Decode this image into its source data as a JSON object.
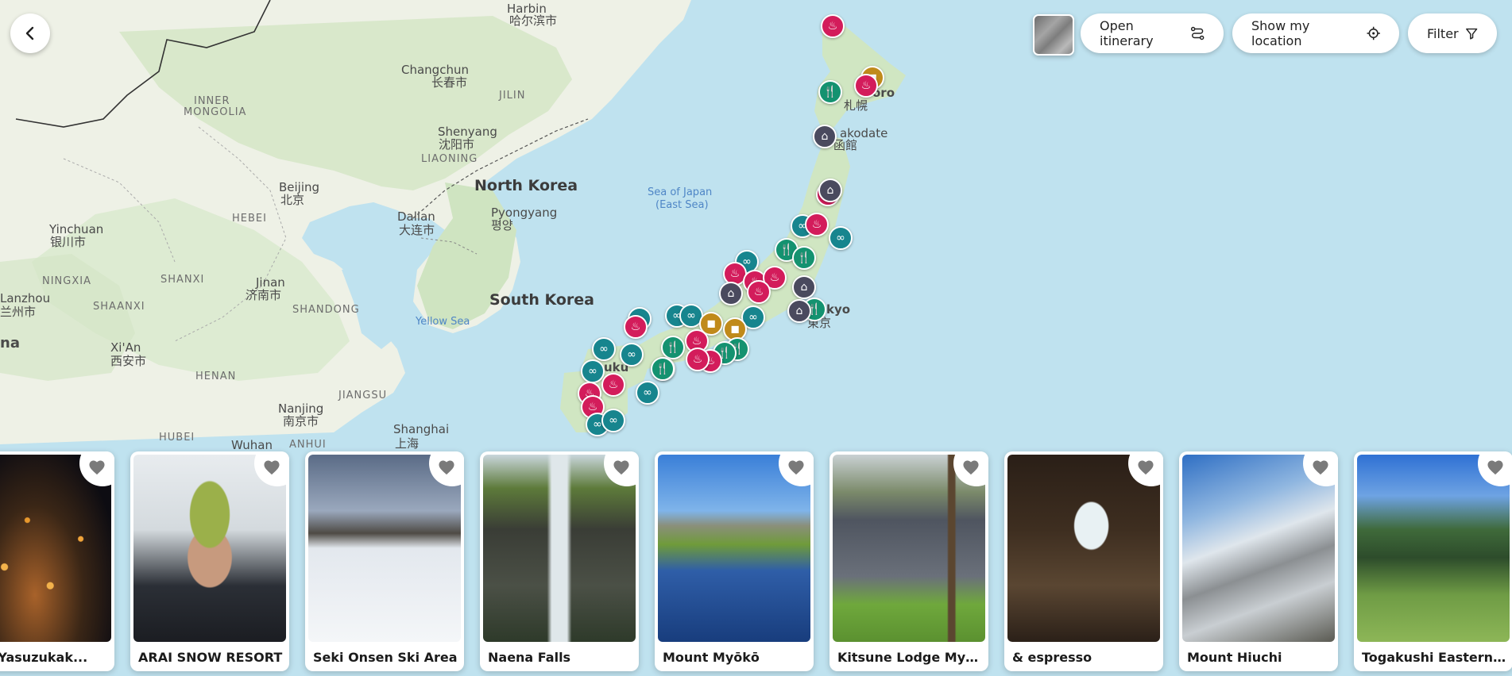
{
  "toolbar": {
    "open_itinerary_label": "Open itinerary",
    "show_location_label": "Show my location",
    "filter_label": "Filter"
  },
  "colors": {
    "food_pin": "#149270",
    "sight_pin": "#17858e",
    "onsen_pin": "#d31c5b",
    "hotel_pin": "#4a4a5e",
    "shop_pin": "#c08a1a",
    "water": "#bfe2ef",
    "land": "#eef1e6"
  },
  "map": {
    "countries": {
      "north_korea": "North Korea",
      "north_korea_local": "Pyongyang",
      "south_korea": "South Korea",
      "inner_mongolia_1": "INNER",
      "inner_mongolia_2": "MONGOLIA"
    },
    "cities": {
      "harbin": "Harbin",
      "harbin_local": "哈尔滨市",
      "changchun": "Changchun",
      "changchun_local": "长春市",
      "shenyang": "Shenyang",
      "shenyang_local": "沈阳市",
      "beijing": "Beijing",
      "beijing_local": "北京",
      "dalian": "Dalian",
      "dalian_local": "大连市",
      "pyongyang_local": "평양",
      "yinchuan": "Yinchuan",
      "yinchuan_local": "银川市",
      "lanzhou": "Lanzhou",
      "lanzhou_local": "兰州市",
      "jinan": "Jinan",
      "jinan_local": "济南市",
      "xian": "Xi'An",
      "xian_local": "西安市",
      "nanjing": "Nanjing",
      "nanjing_local": "南京市",
      "shanghai": "Shanghai",
      "shanghai_local": "上海",
      "wuhan": "Wuhan",
      "sapporo_partial": "oro",
      "sapporo_local": "札幌",
      "hakodate_partial": "akodate",
      "hakodate_local": "函館",
      "tokyo_partial": "kyo",
      "tokyo_local": "東京",
      "fukuoka_partial": "uku",
      "cut_left": "na"
    },
    "regions": {
      "jilin": "JILIN",
      "liaoning": "LIAONING",
      "hebei": "HEBEI",
      "ningxia": "NINGXIA",
      "shanxi": "SHANXI",
      "shaanxi": "SHAANXI",
      "shandong": "SHANDONG",
      "henan": "HENAN",
      "jiangsu": "JIANGSU",
      "hubei": "HUBEI",
      "anhui": "ANHUI"
    },
    "seas": {
      "japan_sea_1": "Sea of Japan",
      "japan_sea_2": "(East Sea)",
      "yellow_sea": "Yellow Sea"
    }
  },
  "cards": [
    {
      "title": "ushi Yasuzukak..."
    },
    {
      "title": "ARAI SNOW RESORT"
    },
    {
      "title": "Seki Onsen Ski Area"
    },
    {
      "title": "Naena Falls"
    },
    {
      "title": "Mount Myōkō"
    },
    {
      "title": "Kitsune Lodge Myoko I..."
    },
    {
      "title": "& espresso"
    },
    {
      "title": "Mount Hiuchi"
    },
    {
      "title": "Togakushi Eastern Ca..."
    }
  ]
}
